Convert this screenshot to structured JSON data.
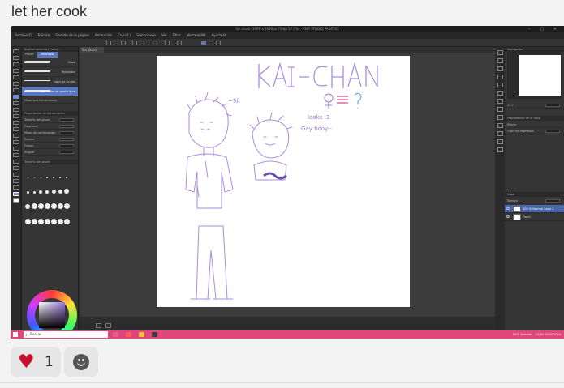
{
  "post": {
    "text": "let her cook"
  },
  "app": {
    "title": "Sin título (1096 x 1046px 72dpi 17.7%) - CLIP STUDIO PAINT EX",
    "menu": [
      "Archivo(F)",
      "Edición",
      "Gestión de la página",
      "Animación",
      "Capa(L)",
      "Selecciones",
      "Ver",
      "Filtro",
      "Ventana(W)",
      "Ayuda(H)"
    ],
    "doc_tab": "Sin título"
  },
  "left_panel": {
    "header": "Subherramienta [Pincel]",
    "tabs": [
      "Pincel",
      "Marcador"
    ],
    "brushes": [
      "Mapa",
      "Rotulador",
      "Lápiz de acción",
      "Rotulador de punta dura"
    ],
    "mode_label": "Modo sub-herramienta",
    "properties_header": "Propiedades de herramienta",
    "properties": [
      {
        "label": "Tamaño del pincel",
        "value": "20.0"
      },
      {
        "label": "Opacidad",
        "value": "100"
      },
      {
        "label": "Modo de combinación",
        "value": "Normal"
      },
      {
        "label": "Dureza",
        "value": ""
      },
      {
        "label": "Grosor",
        "value": "100"
      },
      {
        "label": "Ángulo",
        "value": "90"
      }
    ],
    "size_header": "Tamaño del pincel",
    "sizes": [
      "0.7",
      "1",
      "1.5",
      "2",
      "2.5",
      "3",
      "4",
      "5",
      "6",
      "7",
      "8",
      "10",
      "12",
      "15",
      "17",
      "20"
    ]
  },
  "right_panel": {
    "navigator_header": "Navegador",
    "zoom_value": "17.7",
    "layer_props_header": "Propiedades de la capa",
    "effect_label": "Efecto",
    "color_label": "Color de expresión",
    "color_value": "Color",
    "layer_header": "Capa",
    "blend_value": "Normal",
    "opacity_value": "100",
    "layers": [
      {
        "name": "100 % Normal\nCapa 1",
        "selected": true
      },
      {
        "name": "Papel",
        "selected": false
      }
    ]
  },
  "drawing": {
    "title_text": "KAI-CHAN",
    "note_text": "looks :3\nGay boooy--",
    "side_mark": "~9ft"
  },
  "taskbar": {
    "search_placeholder": "Buscar",
    "weather": "19°C Soleado",
    "time": "12:30",
    "date": "15/04/2024"
  },
  "reactions": {
    "heart_count": "1"
  },
  "colors": {
    "taskbar": "#e0457b",
    "accent": "#5a78c2",
    "sketch": "#9a7ad6",
    "heart": "#c8102e"
  }
}
